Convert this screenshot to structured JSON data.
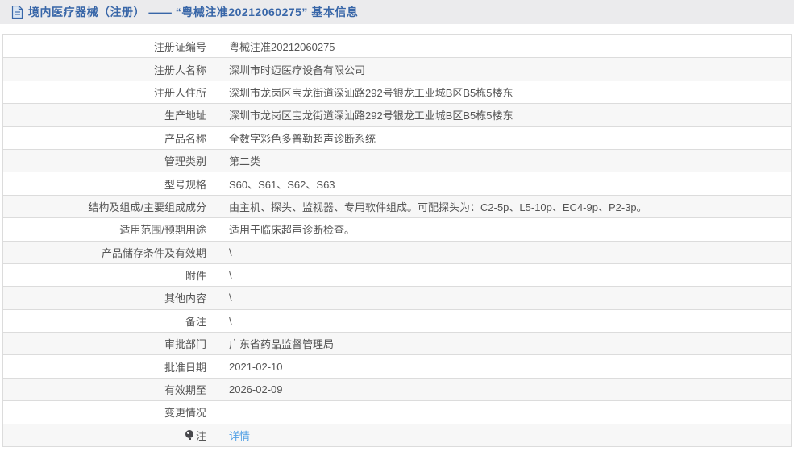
{
  "header": {
    "icon": "document-icon",
    "title": "境内医疗器械（注册） —— “粤械注准20212060275” 基本信息"
  },
  "colors": {
    "header_bg": "#ebebed",
    "title_blue": "#3866a8",
    "border": "#dcdcdc",
    "alt_row_bg": "#f7f7f7",
    "text": "#555555",
    "link_blue": "#52a0e5"
  },
  "table": {
    "rows": [
      {
        "label": "注册证编号",
        "value": "粤械注准20212060275"
      },
      {
        "label": "注册人名称",
        "value": "深圳市时迈医疗设备有限公司"
      },
      {
        "label": "注册人住所",
        "value": "深圳市龙岗区宝龙街道深汕路292号银龙工业城B区B5栋5楼东"
      },
      {
        "label": "生产地址",
        "value": "深圳市龙岗区宝龙街道深汕路292号银龙工业城B区B5栋5楼东"
      },
      {
        "label": "产品名称",
        "value": "全数字彩色多普勒超声诊断系统"
      },
      {
        "label": "管理类别",
        "value": "第二类"
      },
      {
        "label": "型号规格",
        "value": "S60、S61、S62、S63"
      },
      {
        "label": "结构及组成/主要组成成分",
        "value": "由主机、探头、监视器、专用软件组成。可配探头为：C2-5p、L5-10p、EC4-9p、P2-3p。"
      },
      {
        "label": "适用范围/预期用途",
        "value": "适用于临床超声诊断检查。"
      },
      {
        "label": "产品储存条件及有效期",
        "value": "\\"
      },
      {
        "label": "附件",
        "value": "\\"
      },
      {
        "label": "其他内容",
        "value": "\\"
      },
      {
        "label": "备注",
        "value": "\\"
      },
      {
        "label": "审批部门",
        "value": "广东省药品监督管理局"
      },
      {
        "label": "批准日期",
        "value": "2021-02-10"
      },
      {
        "label": "有效期至",
        "value": "2026-02-09"
      },
      {
        "label": "变更情况",
        "value": ""
      },
      {
        "label": "注",
        "label_icon": "bulb-icon",
        "value": "详情",
        "value_is_link": true
      }
    ]
  }
}
